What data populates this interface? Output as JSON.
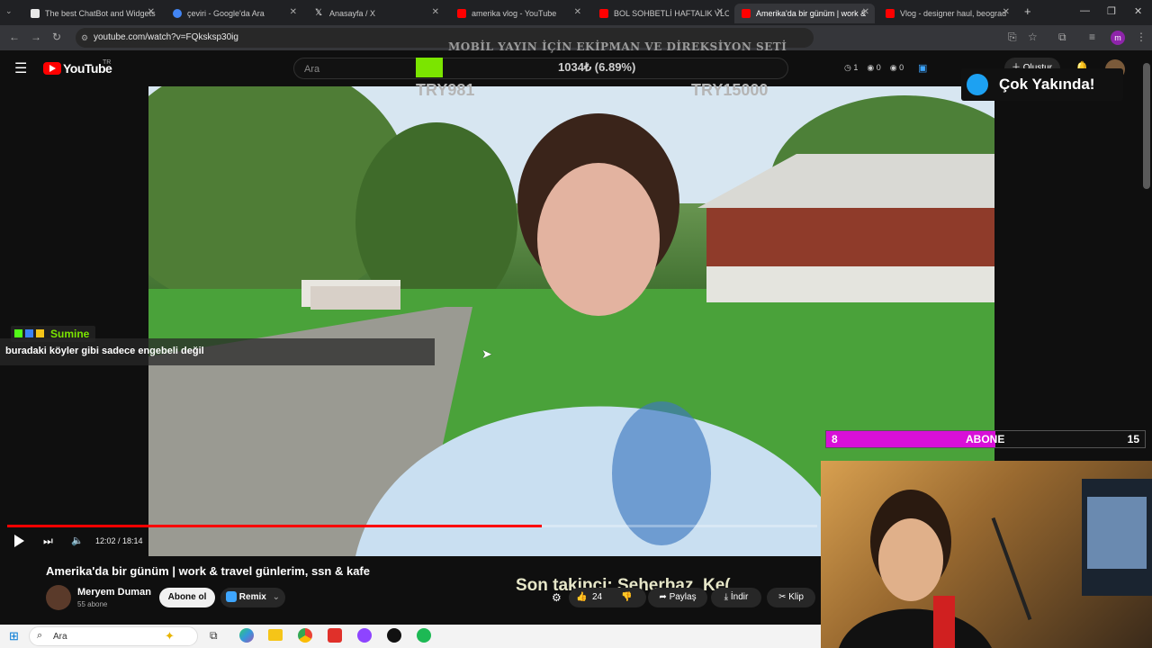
{
  "browser": {
    "tabs": [
      {
        "title": "The best ChatBot and Widgets",
        "fav_color": "#e8e8e8"
      },
      {
        "title": "çeviri - Google'da Ara",
        "fav_color": "#4285f4"
      },
      {
        "title": "Anasayfa / X",
        "fav_color": "#ffffff"
      },
      {
        "title": "amerika vlog - YouTube",
        "fav_color": "#ff0000"
      },
      {
        "title": "BOL SOHBETLİ HAFTALIK VLOG",
        "fav_color": "#ff0000"
      },
      {
        "title": "Amerika'da bir günüm | work &",
        "fav_color": "#ff0000"
      },
      {
        "title": "Vlog - designer haul, beograd",
        "fav_color": "#ff0000"
      }
    ],
    "new_tab": "+",
    "url": "youtube.com/watch?v=FQksksp30ig"
  },
  "youtube": {
    "logo": "YouTube",
    "region": "TR",
    "search_placeholder": "Ara",
    "create_label": "Oluştur"
  },
  "stream_overlay": {
    "top_banner": "MOBİL YAYIN İÇİN EKİPMAN VE DİREKSİYON SETİ",
    "goal_amount": "1034₺ (6.89%)",
    "goal_left": "TRY981",
    "goal_right": "TRY15000",
    "stats": [
      "1",
      "0",
      "0"
    ],
    "coming_soon": "Çok Yakında!",
    "chat_user": "Sumine",
    "chat_message": "buradaki köyler gibi sadece engebeli değil",
    "sub_goal_current": "8",
    "sub_goal_label": "ABONE",
    "sub_goal_target": "15",
    "sub_goal_progress": 0.53,
    "last_follower": "Son takipçi: Seherbaz_Ke("
  },
  "player": {
    "time": "12:02 / 18:14",
    "progress": 0.66
  },
  "video": {
    "title": "Amerika'da bir günüm | work & travel günlerim, ssn & kafe",
    "channel": "Meryem Duman",
    "subscribers": "55 abone",
    "subscribe_label": "Abone ol",
    "remix_label": "Remix",
    "like_count": "24",
    "share_label": "Paylaş",
    "download_label": "İndir",
    "clip_label": "Klip"
  },
  "taskbar": {
    "search_placeholder": "Ara"
  }
}
